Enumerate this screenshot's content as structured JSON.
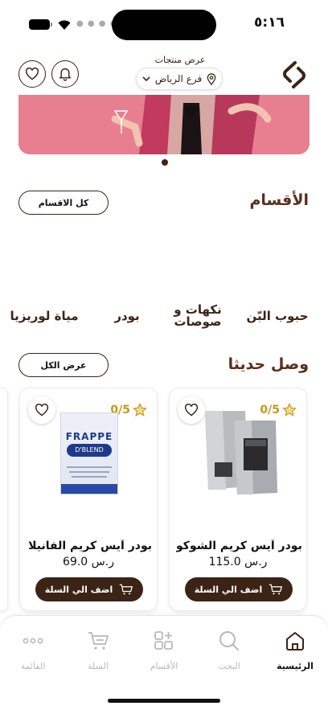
{
  "status": {
    "time": "٥:١٦"
  },
  "header": {
    "caption": "عرض منتجات",
    "branch": "فرع الرياض"
  },
  "categories": {
    "title": "الأقسام",
    "all_button": "كل الاقسام",
    "items": [
      {
        "label": "حبوب البّن"
      },
      {
        "label": "نكهات و صوصات"
      },
      {
        "label": "بودر"
      },
      {
        "label": "مياة لوريزيا"
      }
    ]
  },
  "new_arrivals": {
    "title": "وصل حديثا",
    "view_all_button": "عرض الكل",
    "products": [
      {
        "name": "بودر آيس كريم الشوكو...",
        "price": "115.0 ر.س",
        "rating": "0/5",
        "cart_label": "اضف الي السلة",
        "image": "silver-coffee-bags"
      },
      {
        "name": "بودر آيس كريم الفانيلا",
        "price": "69.0 ر.س",
        "rating": "0/5",
        "cart_label": "اضف الي السلة",
        "image": "frappe-dblend-bag",
        "image_text": "FRAPPE",
        "image_brand": "D'BLEND"
      }
    ]
  },
  "tabbar": {
    "items": [
      {
        "label": "الرئيسية",
        "icon": "home-icon",
        "active": true
      },
      {
        "label": "البحث",
        "icon": "search-icon",
        "active": false
      },
      {
        "label": "الأقسام",
        "icon": "grid-plus-icon",
        "active": false
      },
      {
        "label": "السلة",
        "icon": "cart-icon",
        "active": false
      },
      {
        "label": "القائمة",
        "icon": "more-icon",
        "active": false
      }
    ]
  },
  "colors": {
    "brand": "#3b2415",
    "heading": "#5a2f1c",
    "rating": "#c69a1b",
    "inactive": "#b9b9b9"
  }
}
